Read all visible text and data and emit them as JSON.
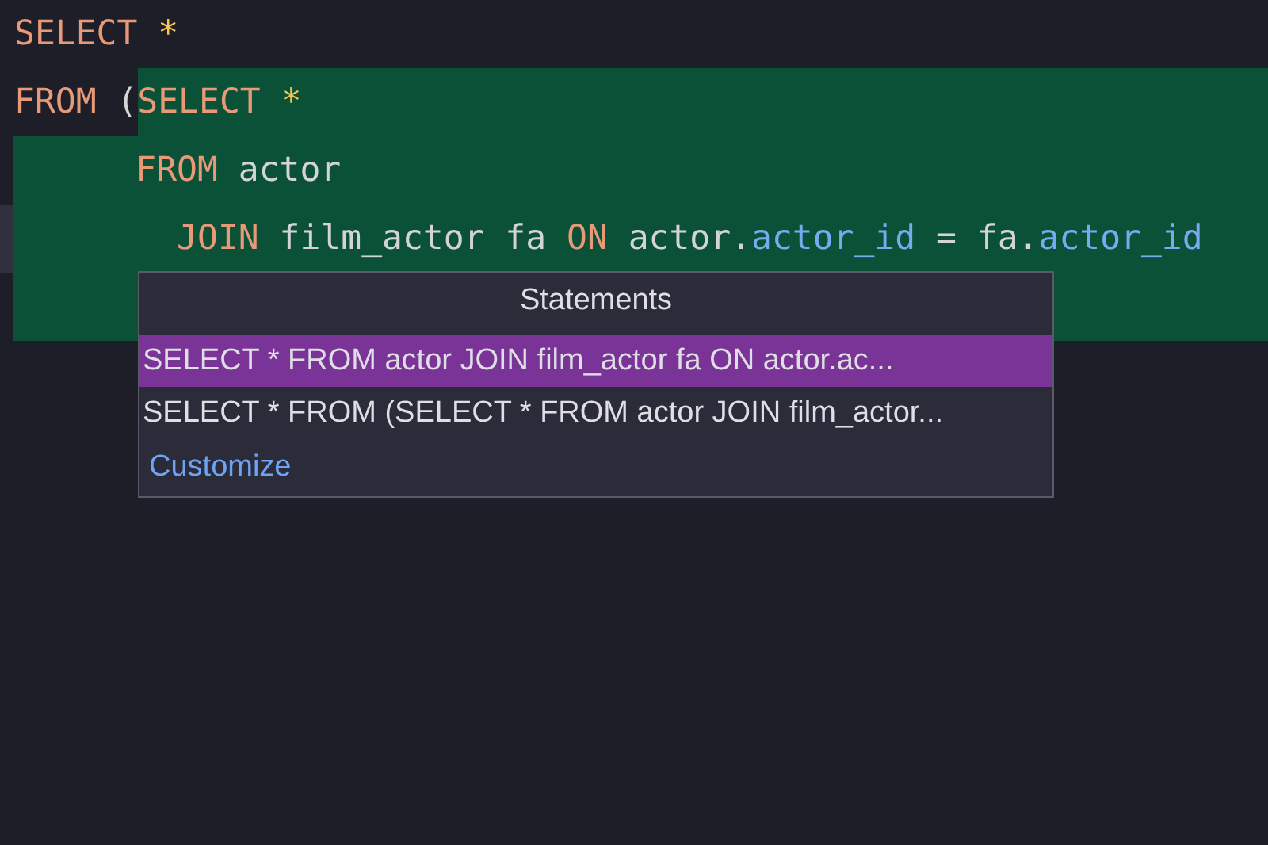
{
  "editor": {
    "lines": [
      {
        "selected": false,
        "current": false,
        "plain": [
          {
            "text": "SELECT",
            "kind": "keyword"
          },
          {
            "text": " *",
            "kind": "star"
          }
        ]
      },
      {
        "selected": false,
        "current": false,
        "plain": [
          {
            "text": "FROM",
            "kind": "keyword"
          },
          {
            "text": " (",
            "kind": "punct"
          }
        ],
        "marked": [
          {
            "text": "SELECT",
            "kind": "keyword"
          },
          {
            "text": " *",
            "kind": "star"
          }
        ]
      },
      {
        "selected": true,
        "current": false,
        "marked": [
          {
            "text": "      FROM",
            "kind": "keyword"
          },
          {
            "text": " actor",
            "kind": "ident"
          }
        ]
      },
      {
        "selected": true,
        "current": true,
        "marked": [
          {
            "text": "        JOIN",
            "kind": "keyword"
          },
          {
            "text": " film_actor fa",
            "kind": "ident"
          },
          {
            "text": " ON",
            "kind": "keyword"
          },
          {
            "text": " actor.",
            "kind": "ident"
          },
          {
            "text": "actor_id",
            "kind": "field"
          },
          {
            "text": " = fa.",
            "kind": "ident"
          },
          {
            "text": "actor_id",
            "kind": "field"
          }
        ]
      },
      {
        "selected": true,
        "current": false
      }
    ]
  },
  "popup": {
    "title": "Statements",
    "items": [
      {
        "text": "SELECT * FROM actor JOIN film_actor fa ON actor.ac...",
        "selected": true
      },
      {
        "text": "SELECT * FROM (SELECT * FROM actor JOIN film_actor...",
        "selected": false
      }
    ],
    "link": "Customize"
  }
}
